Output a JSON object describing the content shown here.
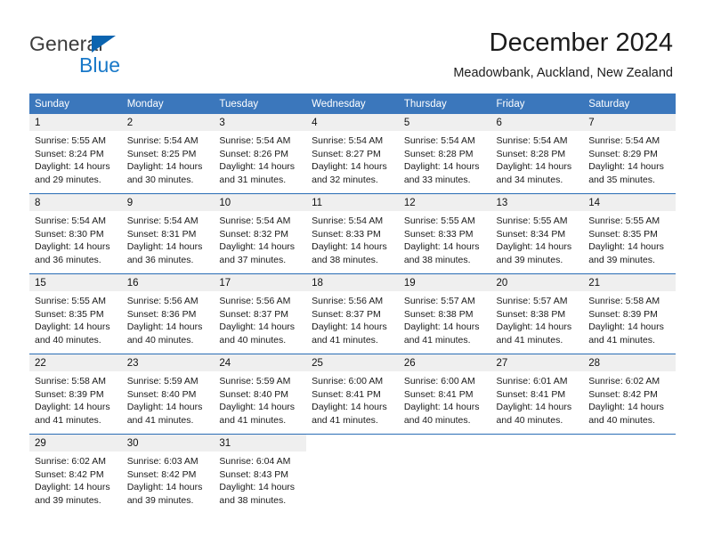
{
  "brand": {
    "word_one": "General",
    "word_two": "Blue",
    "triangle_color": "#0b64b0",
    "blue_text_color": "#1878c8"
  },
  "header": {
    "title": "December 2024",
    "location": "Meadowbank, Auckland, New Zealand"
  },
  "theme": {
    "header_blue": "#3b77bc",
    "row_divider_blue": "#2a6db5",
    "daynum_band_gray": "#efefef"
  },
  "calendar": {
    "weekday_headers": [
      "Sunday",
      "Monday",
      "Tuesday",
      "Wednesday",
      "Thursday",
      "Friday",
      "Saturday"
    ],
    "weeks": [
      [
        {
          "day": "1",
          "sunrise": "Sunrise: 5:55 AM",
          "sunset": "Sunset: 8:24 PM",
          "daylight_1": "Daylight: 14 hours",
          "daylight_2": "and 29 minutes."
        },
        {
          "day": "2",
          "sunrise": "Sunrise: 5:54 AM",
          "sunset": "Sunset: 8:25 PM",
          "daylight_1": "Daylight: 14 hours",
          "daylight_2": "and 30 minutes."
        },
        {
          "day": "3",
          "sunrise": "Sunrise: 5:54 AM",
          "sunset": "Sunset: 8:26 PM",
          "daylight_1": "Daylight: 14 hours",
          "daylight_2": "and 31 minutes."
        },
        {
          "day": "4",
          "sunrise": "Sunrise: 5:54 AM",
          "sunset": "Sunset: 8:27 PM",
          "daylight_1": "Daylight: 14 hours",
          "daylight_2": "and 32 minutes."
        },
        {
          "day": "5",
          "sunrise": "Sunrise: 5:54 AM",
          "sunset": "Sunset: 8:28 PM",
          "daylight_1": "Daylight: 14 hours",
          "daylight_2": "and 33 minutes."
        },
        {
          "day": "6",
          "sunrise": "Sunrise: 5:54 AM",
          "sunset": "Sunset: 8:28 PM",
          "daylight_1": "Daylight: 14 hours",
          "daylight_2": "and 34 minutes."
        },
        {
          "day": "7",
          "sunrise": "Sunrise: 5:54 AM",
          "sunset": "Sunset: 8:29 PM",
          "daylight_1": "Daylight: 14 hours",
          "daylight_2": "and 35 minutes."
        }
      ],
      [
        {
          "day": "8",
          "sunrise": "Sunrise: 5:54 AM",
          "sunset": "Sunset: 8:30 PM",
          "daylight_1": "Daylight: 14 hours",
          "daylight_2": "and 36 minutes."
        },
        {
          "day": "9",
          "sunrise": "Sunrise: 5:54 AM",
          "sunset": "Sunset: 8:31 PM",
          "daylight_1": "Daylight: 14 hours",
          "daylight_2": "and 36 minutes."
        },
        {
          "day": "10",
          "sunrise": "Sunrise: 5:54 AM",
          "sunset": "Sunset: 8:32 PM",
          "daylight_1": "Daylight: 14 hours",
          "daylight_2": "and 37 minutes."
        },
        {
          "day": "11",
          "sunrise": "Sunrise: 5:54 AM",
          "sunset": "Sunset: 8:33 PM",
          "daylight_1": "Daylight: 14 hours",
          "daylight_2": "and 38 minutes."
        },
        {
          "day": "12",
          "sunrise": "Sunrise: 5:55 AM",
          "sunset": "Sunset: 8:33 PM",
          "daylight_1": "Daylight: 14 hours",
          "daylight_2": "and 38 minutes."
        },
        {
          "day": "13",
          "sunrise": "Sunrise: 5:55 AM",
          "sunset": "Sunset: 8:34 PM",
          "daylight_1": "Daylight: 14 hours",
          "daylight_2": "and 39 minutes."
        },
        {
          "day": "14",
          "sunrise": "Sunrise: 5:55 AM",
          "sunset": "Sunset: 8:35 PM",
          "daylight_1": "Daylight: 14 hours",
          "daylight_2": "and 39 minutes."
        }
      ],
      [
        {
          "day": "15",
          "sunrise": "Sunrise: 5:55 AM",
          "sunset": "Sunset: 8:35 PM",
          "daylight_1": "Daylight: 14 hours",
          "daylight_2": "and 40 minutes."
        },
        {
          "day": "16",
          "sunrise": "Sunrise: 5:56 AM",
          "sunset": "Sunset: 8:36 PM",
          "daylight_1": "Daylight: 14 hours",
          "daylight_2": "and 40 minutes."
        },
        {
          "day": "17",
          "sunrise": "Sunrise: 5:56 AM",
          "sunset": "Sunset: 8:37 PM",
          "daylight_1": "Daylight: 14 hours",
          "daylight_2": "and 40 minutes."
        },
        {
          "day": "18",
          "sunrise": "Sunrise: 5:56 AM",
          "sunset": "Sunset: 8:37 PM",
          "daylight_1": "Daylight: 14 hours",
          "daylight_2": "and 41 minutes."
        },
        {
          "day": "19",
          "sunrise": "Sunrise: 5:57 AM",
          "sunset": "Sunset: 8:38 PM",
          "daylight_1": "Daylight: 14 hours",
          "daylight_2": "and 41 minutes."
        },
        {
          "day": "20",
          "sunrise": "Sunrise: 5:57 AM",
          "sunset": "Sunset: 8:38 PM",
          "daylight_1": "Daylight: 14 hours",
          "daylight_2": "and 41 minutes."
        },
        {
          "day": "21",
          "sunrise": "Sunrise: 5:58 AM",
          "sunset": "Sunset: 8:39 PM",
          "daylight_1": "Daylight: 14 hours",
          "daylight_2": "and 41 minutes."
        }
      ],
      [
        {
          "day": "22",
          "sunrise": "Sunrise: 5:58 AM",
          "sunset": "Sunset: 8:39 PM",
          "daylight_1": "Daylight: 14 hours",
          "daylight_2": "and 41 minutes."
        },
        {
          "day": "23",
          "sunrise": "Sunrise: 5:59 AM",
          "sunset": "Sunset: 8:40 PM",
          "daylight_1": "Daylight: 14 hours",
          "daylight_2": "and 41 minutes."
        },
        {
          "day": "24",
          "sunrise": "Sunrise: 5:59 AM",
          "sunset": "Sunset: 8:40 PM",
          "daylight_1": "Daylight: 14 hours",
          "daylight_2": "and 41 minutes."
        },
        {
          "day": "25",
          "sunrise": "Sunrise: 6:00 AM",
          "sunset": "Sunset: 8:41 PM",
          "daylight_1": "Daylight: 14 hours",
          "daylight_2": "and 41 minutes."
        },
        {
          "day": "26",
          "sunrise": "Sunrise: 6:00 AM",
          "sunset": "Sunset: 8:41 PM",
          "daylight_1": "Daylight: 14 hours",
          "daylight_2": "and 40 minutes."
        },
        {
          "day": "27",
          "sunrise": "Sunrise: 6:01 AM",
          "sunset": "Sunset: 8:41 PM",
          "daylight_1": "Daylight: 14 hours",
          "daylight_2": "and 40 minutes."
        },
        {
          "day": "28",
          "sunrise": "Sunrise: 6:02 AM",
          "sunset": "Sunset: 8:42 PM",
          "daylight_1": "Daylight: 14 hours",
          "daylight_2": "and 40 minutes."
        }
      ],
      [
        {
          "day": "29",
          "sunrise": "Sunrise: 6:02 AM",
          "sunset": "Sunset: 8:42 PM",
          "daylight_1": "Daylight: 14 hours",
          "daylight_2": "and 39 minutes."
        },
        {
          "day": "30",
          "sunrise": "Sunrise: 6:03 AM",
          "sunset": "Sunset: 8:42 PM",
          "daylight_1": "Daylight: 14 hours",
          "daylight_2": "and 39 minutes."
        },
        {
          "day": "31",
          "sunrise": "Sunrise: 6:04 AM",
          "sunset": "Sunset: 8:43 PM",
          "daylight_1": "Daylight: 14 hours",
          "daylight_2": "and 38 minutes."
        },
        {
          "day": "",
          "sunrise": "",
          "sunset": "",
          "daylight_1": "",
          "daylight_2": "",
          "blank": true
        },
        {
          "day": "",
          "sunrise": "",
          "sunset": "",
          "daylight_1": "",
          "daylight_2": "",
          "blank": true
        },
        {
          "day": "",
          "sunrise": "",
          "sunset": "",
          "daylight_1": "",
          "daylight_2": "",
          "blank": true
        },
        {
          "day": "",
          "sunrise": "",
          "sunset": "",
          "daylight_1": "",
          "daylight_2": "",
          "blank": true
        }
      ]
    ]
  }
}
